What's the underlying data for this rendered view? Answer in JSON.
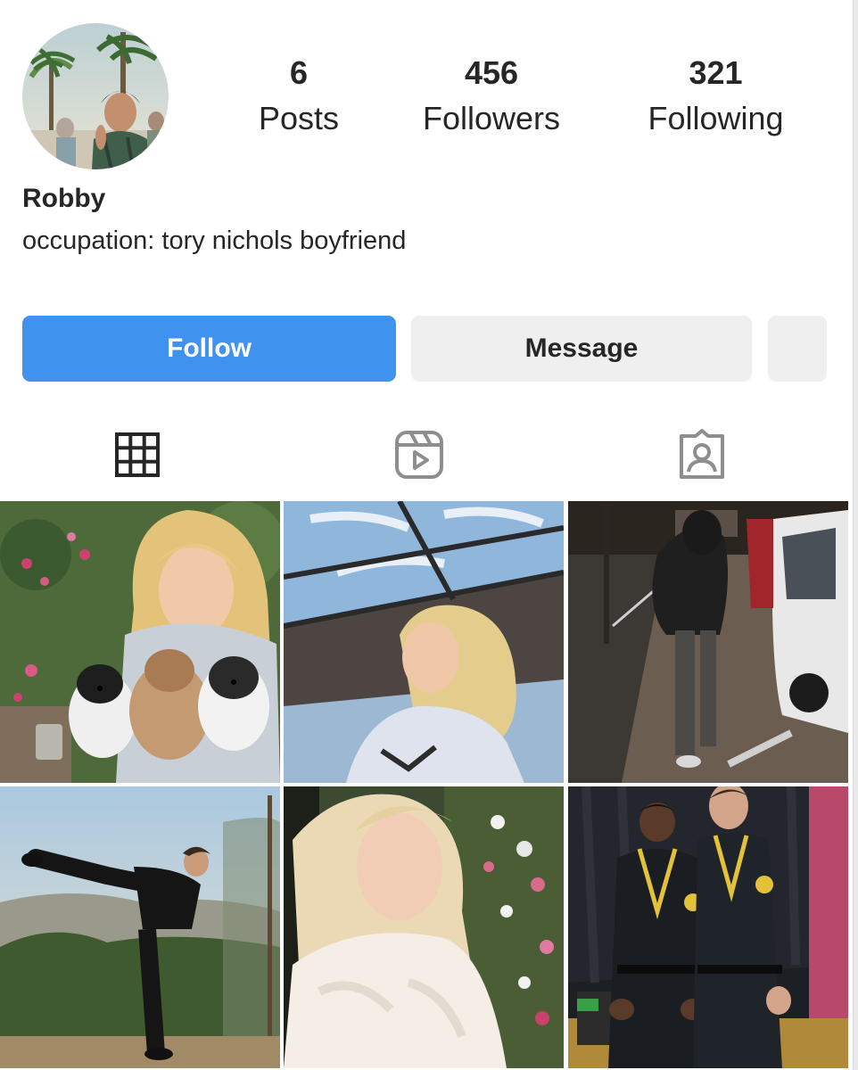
{
  "profile": {
    "username": "Robby",
    "bio": "occupation: tory nichols boyfriend",
    "avatar_icon": "profile-photo"
  },
  "stats": {
    "posts_count": "6",
    "posts_label": "Posts",
    "followers_count": "456",
    "followers_label": "Followers",
    "following_count": "321",
    "following_label": "Following"
  },
  "actions": {
    "follow_label": "Follow",
    "message_label": "Message",
    "follow_color": "#3f92ed"
  },
  "tabs": [
    {
      "icon": "grid-icon",
      "active": true
    },
    {
      "icon": "reels-icon",
      "active": false
    },
    {
      "icon": "tagged-icon",
      "active": false
    }
  ],
  "posts": [
    {
      "subject": "girl-with-puppies-photo"
    },
    {
      "subject": "girl-under-skylight-photo"
    },
    {
      "subject": "night-street-photo"
    },
    {
      "subject": "karate-kick-photo"
    },
    {
      "subject": "blonde-girl-fur-coat-photo"
    },
    {
      "subject": "two-karate-students-photo"
    }
  ]
}
